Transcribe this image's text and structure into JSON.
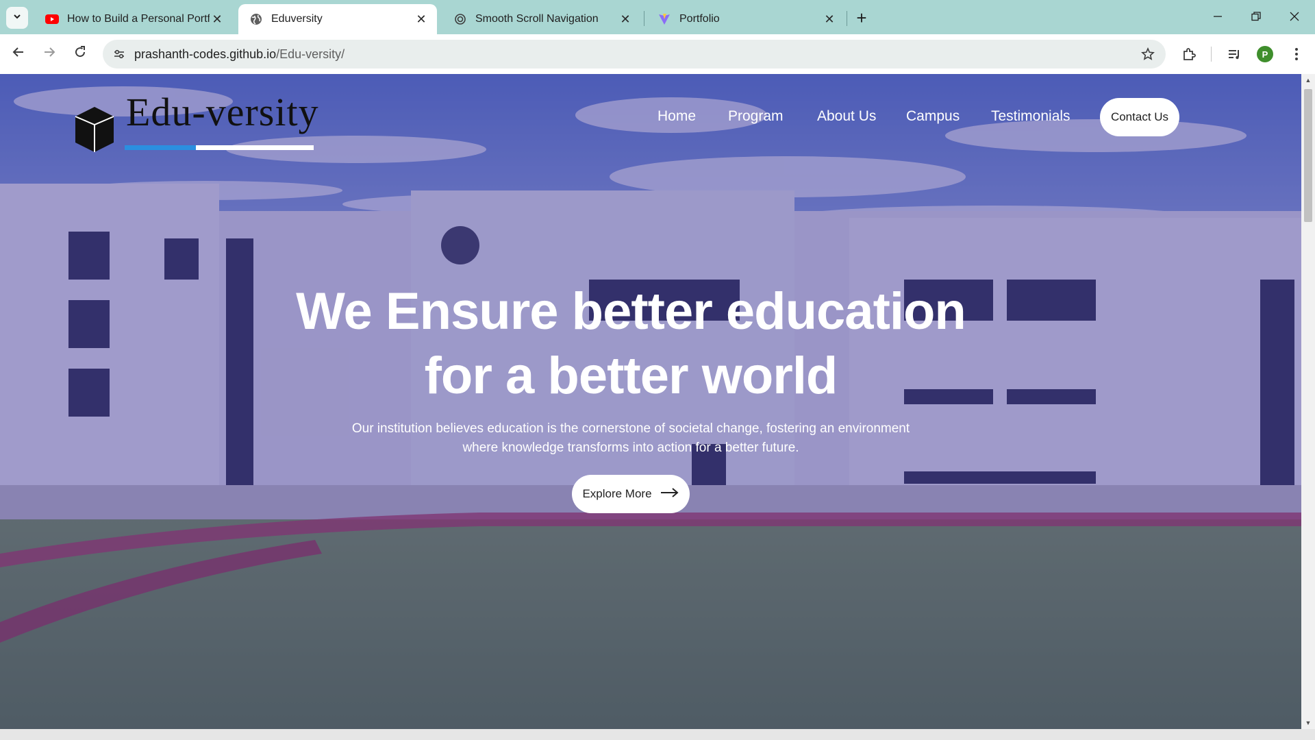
{
  "browser": {
    "tabs": [
      {
        "title": "How to Build a Personal Portfoli",
        "favicon": "youtube-icon",
        "active": false
      },
      {
        "title": "Eduversity",
        "favicon": "globe-icon",
        "active": true
      },
      {
        "title": "Smooth Scroll Navigation",
        "favicon": "openai-icon",
        "active": false
      },
      {
        "title": "Portfolio",
        "favicon": "vite-icon",
        "active": false
      }
    ],
    "url_host": "prashanth-codes.github.io",
    "url_path": "/Edu-versity/",
    "profile_initial": "P",
    "colors": {
      "tabbar": "#a9d6d2",
      "avatar": "#3f8e2c"
    }
  },
  "site": {
    "logo_text": "Edu-versity",
    "nav": [
      "Home",
      "Program",
      "About Us",
      "Campus",
      "Testimonials"
    ],
    "contact_label": "Contact Us",
    "headline_line1": "We Ensure better education",
    "headline_line2": "for a better world",
    "sub_line1": "Our institution believes education is the cornerstone of societal change, fostering an environment",
    "sub_line2": "where knowledge transforms into action for a better future.",
    "explore_label": "Explore More",
    "colors": {
      "overlay": "#3c3096",
      "accent_bar": "#2b8fe0"
    }
  }
}
